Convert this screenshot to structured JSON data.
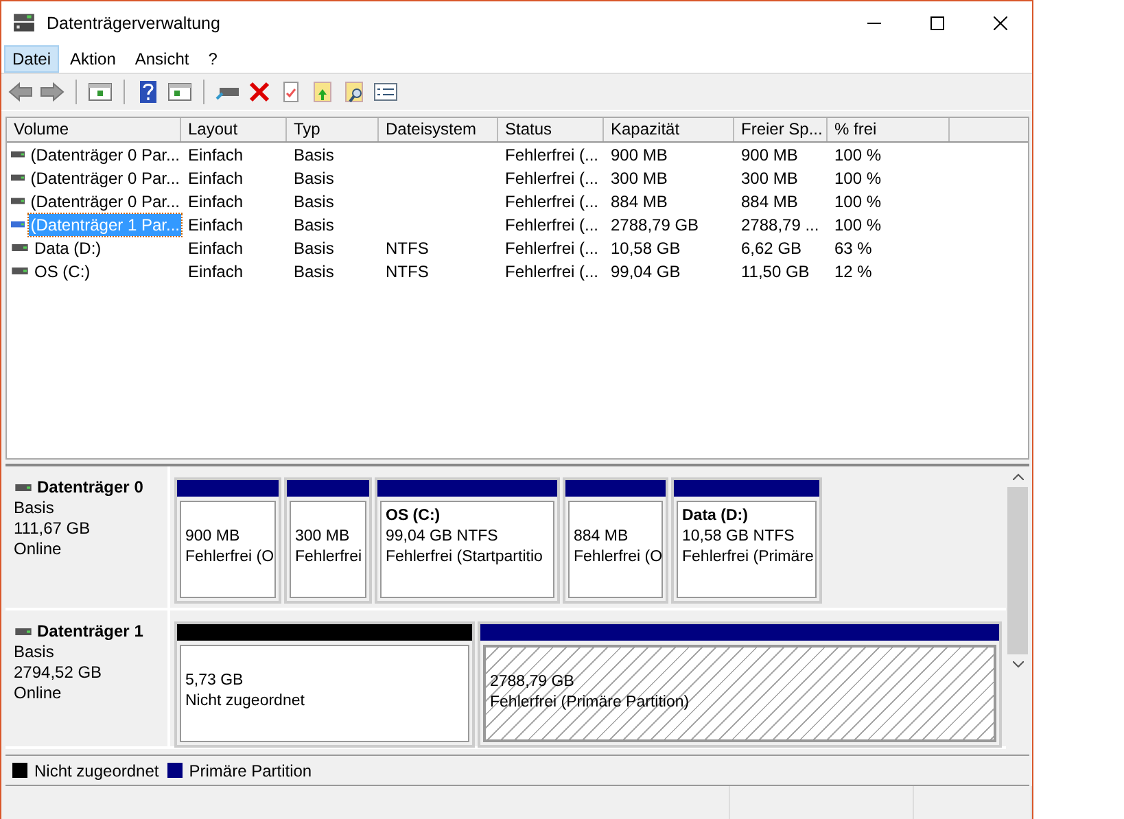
{
  "window": {
    "title": "Datenträgerverwaltung"
  },
  "menu": [
    {
      "label": "Datei",
      "selected": true
    },
    {
      "label": "Aktion",
      "selected": false
    },
    {
      "label": "Ansicht",
      "selected": false
    },
    {
      "label": "?",
      "selected": false
    }
  ],
  "table": {
    "columns": [
      "Volume",
      "Layout",
      "Typ",
      "Dateisystem",
      "Status",
      "Kapazität",
      "Freier Sp...",
      "% frei"
    ],
    "rows": [
      {
        "cells": [
          "(Datenträger 0 Par...",
          "Einfach",
          "Basis",
          "",
          "Fehlerfrei (...",
          "900 MB",
          "900 MB",
          "100 %"
        ],
        "selected": false
      },
      {
        "cells": [
          "(Datenträger 0 Par...",
          "Einfach",
          "Basis",
          "",
          "Fehlerfrei (...",
          "300 MB",
          "300 MB",
          "100 %"
        ],
        "selected": false
      },
      {
        "cells": [
          "(Datenträger 0 Par...",
          "Einfach",
          "Basis",
          "",
          "Fehlerfrei (...",
          "884 MB",
          "884 MB",
          "100 %"
        ],
        "selected": false
      },
      {
        "cells": [
          "(Datenträger 1 Par...",
          "Einfach",
          "Basis",
          "",
          "Fehlerfrei (...",
          "2788,79 GB",
          "2788,79 ...",
          "100 %"
        ],
        "selected": true
      },
      {
        "cells": [
          "Data (D:)",
          "Einfach",
          "Basis",
          "NTFS",
          "Fehlerfrei (...",
          "10,58 GB",
          "6,62 GB",
          "63 %"
        ],
        "selected": false
      },
      {
        "cells": [
          "OS (C:)",
          "Einfach",
          "Basis",
          "NTFS",
          "Fehlerfrei (...",
          "99,04 GB",
          "11,50 GB",
          "12 %"
        ],
        "selected": false
      }
    ]
  },
  "disks": [
    {
      "name": "Datenträger 0",
      "type": "Basis",
      "size": "111,67 GB",
      "state": "Online",
      "partitions": [
        {
          "kind": "primary",
          "size": "900 MB",
          "status": "Fehlerfrei (O",
          "selected": false
        },
        {
          "kind": "primary",
          "size": "300 MB",
          "status": "Fehlerfrei",
          "selected": false
        },
        {
          "kind": "primary",
          "name": "OS  (C:)",
          "size": "99,04 GB NTFS",
          "status": "Fehlerfrei (Startpartitio",
          "selected": false
        },
        {
          "kind": "primary",
          "size": "884 MB",
          "status": "Fehlerfrei (O",
          "selected": false
        },
        {
          "kind": "primary",
          "name": "Data  (D:)",
          "size": "10,58 GB NTFS",
          "status": "Fehlerfrei (Primäre",
          "selected": false
        }
      ]
    },
    {
      "name": "Datenträger 1",
      "type": "Basis",
      "size": "2794,52 GB",
      "state": "Online",
      "partitions": [
        {
          "kind": "unallocated",
          "size": "5,73 GB",
          "status": "Nicht zugeordnet",
          "selected": false
        },
        {
          "kind": "primary",
          "size": "2788,79 GB",
          "status": "Fehlerfrei (Primäre Partition)",
          "selected": true
        }
      ]
    }
  ],
  "legend": [
    {
      "label": "Nicht zugeordnet",
      "color": "#000000"
    },
    {
      "label": "Primäre Partition",
      "color": "#000080"
    }
  ]
}
